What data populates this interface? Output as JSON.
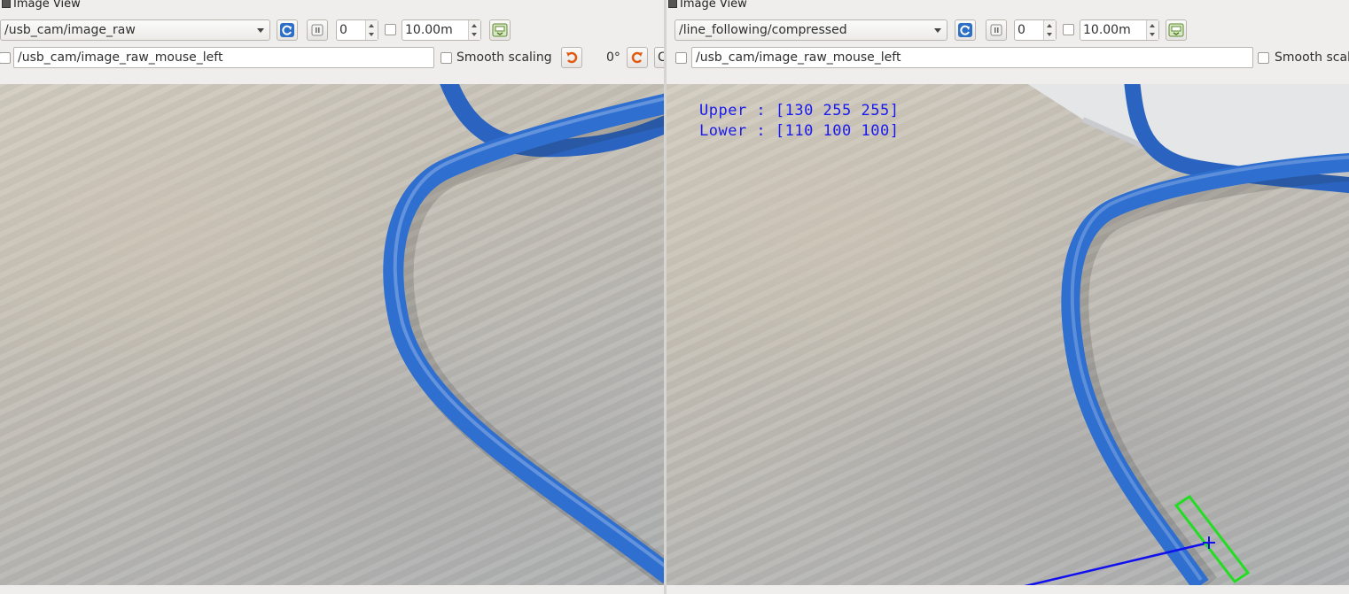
{
  "left": {
    "window_title": "Image View",
    "topic": "/usb_cam/image_raw",
    "spin_value": "0",
    "timeout_value": "10.00m",
    "mouse_topic": "/usb_cam/image_raw_mouse_left",
    "smooth_scaling_label": "Smooth scaling",
    "rotation_label": "0°",
    "cut_button_label": "C"
  },
  "right": {
    "window_title": "Image View",
    "topic": "/line_following/compressed",
    "spin_value": "0",
    "timeout_value": "10.00m",
    "mouse_topic": "/usb_cam/image_raw_mouse_left",
    "smooth_scaling_label": "Smooth scali",
    "overlay": {
      "upper": "Upper : [130 255 255]",
      "lower": "Lower : [110 100 100]"
    }
  },
  "icons": {
    "refresh": "refresh-icon",
    "pause": "pause-icon",
    "save": "save-icon",
    "rotate_left": "rotate-left-icon",
    "rotate_right": "rotate-right-icon"
  },
  "colors": {
    "cable": "#2f6fd0",
    "overlay_text": "#1a1aee",
    "detection_box": "#22dd22",
    "direction_line": "#1010ee"
  }
}
